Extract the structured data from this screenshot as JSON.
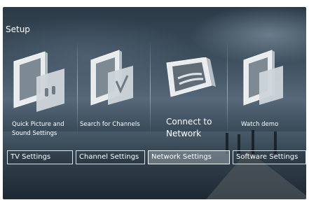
{
  "title": "Setup",
  "tiles": [
    {
      "label_line1": "Quick Picture and",
      "label_line2": "Sound Settings",
      "icon": "tv-picture-sound-icon"
    },
    {
      "label_line1": "Search for Channels",
      "icon": "tv-search-channels-icon"
    },
    {
      "label_line1": "Connect to",
      "label_line2": "Network",
      "icon": "tv-network-icon"
    },
    {
      "label_line1": "Watch demo",
      "icon": "tv-demo-icon"
    }
  ],
  "buttons": [
    {
      "label": "TV Settings",
      "selected": false
    },
    {
      "label": "Channel Settings",
      "selected": false
    },
    {
      "label": "Network Settings",
      "selected": true
    },
    {
      "label": "Software Settings",
      "selected": false
    }
  ],
  "colors": {
    "text": "#ffffff",
    "selected_bg": "#969fa8",
    "border": "#ffffff"
  }
}
